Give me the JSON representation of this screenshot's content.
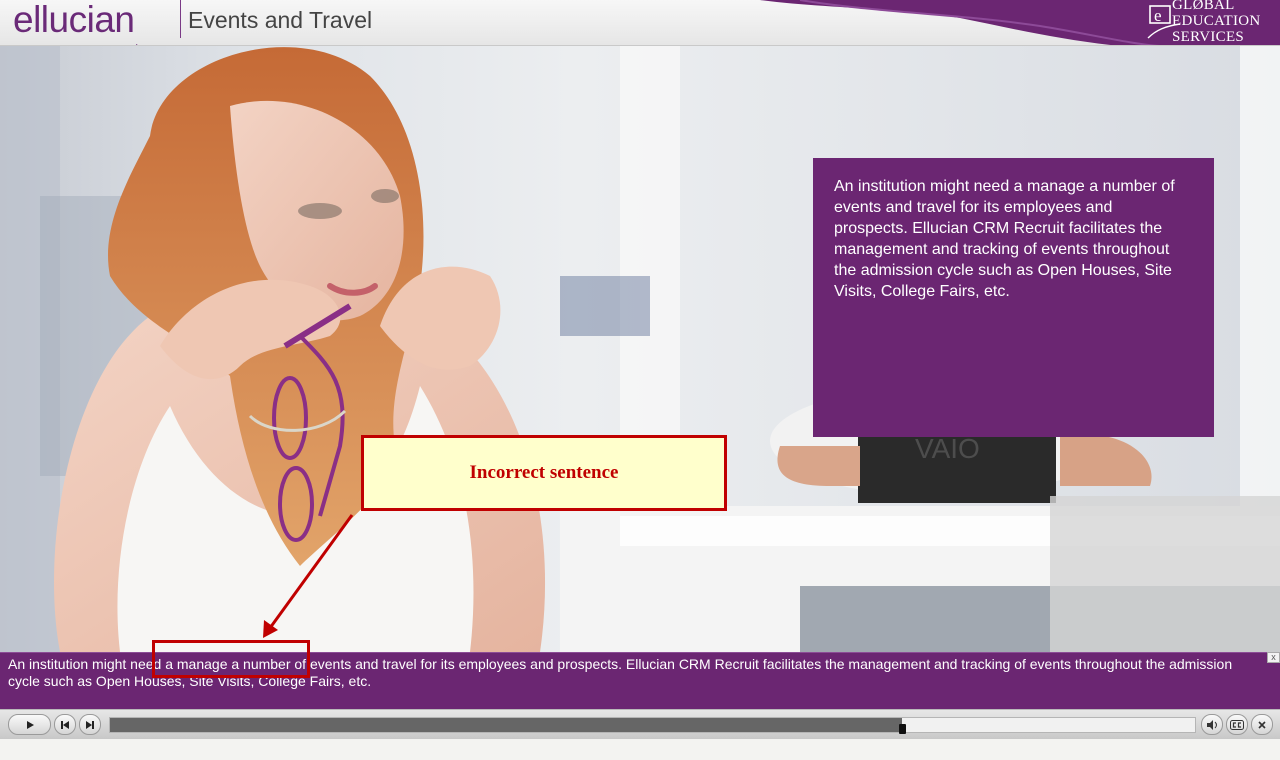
{
  "header": {
    "logo_text": "ellucian",
    "logo_trademark": ".",
    "title": "Events and Travel",
    "brand_lines": [
      "GLØBAL",
      "EDUCATION",
      "SERVICES"
    ],
    "brand_mark_letter": "e"
  },
  "slide": {
    "panel_text": "An institution might need a manage a number of events and travel for its employees and prospects. Ellucian CRM Recruit facilitates the management and tracking of events throughout the admission cycle such as Open Houses, Site Visits, College Fairs, etc.",
    "annotation": {
      "label": "Incorrect sentence"
    }
  },
  "caption": {
    "text": "An institution might need a manage a number of events and travel for its employees and prospects. Ellucian CRM Recruit facilitates the management and tracking of events throughout the admission cycle such as Open Houses, Site Visits, College Fairs, etc.",
    "close_glyph": "x"
  },
  "player": {
    "progress": 0.73,
    "buttons": [
      "play",
      "previous",
      "next",
      "volume",
      "closed-captions",
      "close"
    ]
  },
  "colors": {
    "brand_purple": "#6b2672",
    "annotation_red": "#c00000",
    "annotation_fill": "#ffffcc"
  }
}
